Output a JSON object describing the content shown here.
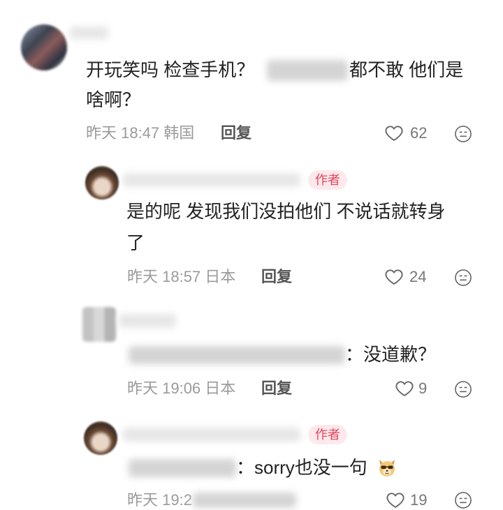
{
  "comments": [
    {
      "line1_start": "开玩笑吗 检查手机？",
      "line1_end": "都不敢 他们是",
      "line2": "啥啊？",
      "meta": "昨天 18:47 韩国",
      "reply_label": "回复",
      "likes": "62"
    },
    {
      "badge": "作者",
      "line1": "是的呢 发现我们没拍他们 不说话就转身",
      "line2": "了",
      "meta": "昨天 18:57 日本",
      "reply_label": "回复",
      "likes": "24"
    },
    {
      "line1": "：没道歉？",
      "meta": "昨天 19:06 日本",
      "reply_label": "回复",
      "likes": "9"
    },
    {
      "badge": "作者",
      "line1": "：sorry也没一句",
      "meta": "昨天 19:2",
      "likes": "19"
    }
  ],
  "icons": {
    "like": "heart-icon",
    "react": "emoji-face-icon",
    "inline_emoji": "sunglasses-dog-emoji"
  },
  "colors": {
    "text": "#222222",
    "meta": "#9a9a9a",
    "badge_bg": "#fde9ec",
    "badge_text": "#e6455a"
  }
}
